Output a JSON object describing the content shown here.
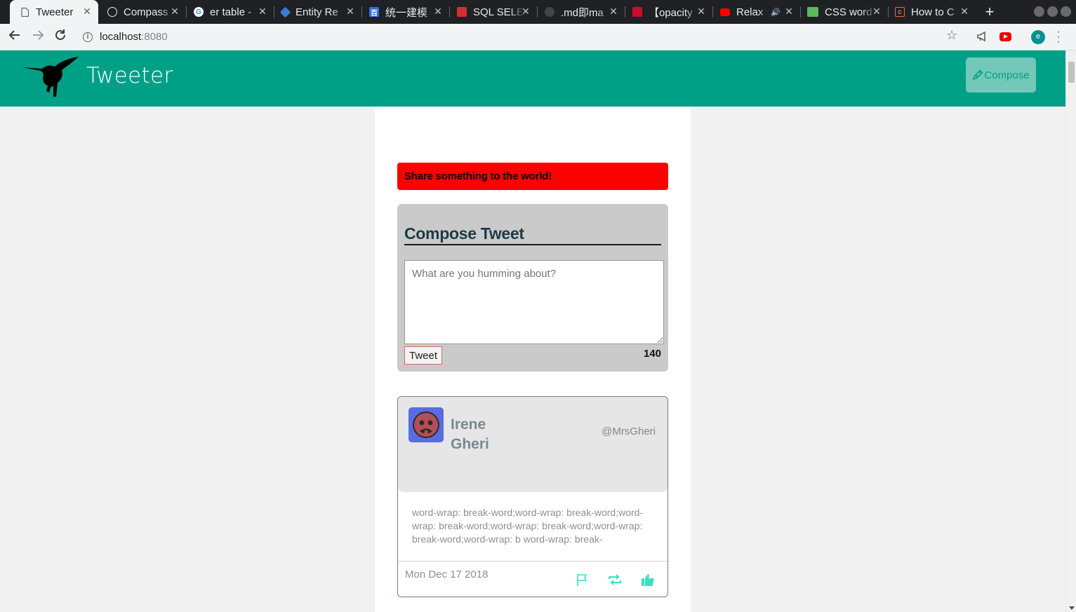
{
  "browser": {
    "tabs": [
      {
        "title": "Tweeter",
        "icon": "doc-icon",
        "active": true
      },
      {
        "title": "Compass",
        "icon": "compass-icon"
      },
      {
        "title": "er table -",
        "icon": "google-icon"
      },
      {
        "title": "Entity Re",
        "icon": "puzzle-icon"
      },
      {
        "title": "统一建模",
        "icon": "baidu-icon"
      },
      {
        "title": "SQL SELE",
        "icon": "sql-icon"
      },
      {
        "title": ".md即ma",
        "icon": "github-icon"
      },
      {
        "title": "【opacity",
        "icon": "csdn-icon"
      },
      {
        "title": "Relax",
        "icon": "youtube-icon"
      },
      {
        "title": "CSS word",
        "icon": "css-icon"
      },
      {
        "title": "How to C",
        "icon": "codepen-icon"
      }
    ],
    "url_host": "localhost",
    "url_port": ":8080",
    "profile_initial": "e"
  },
  "header": {
    "brand": "Tweeter",
    "compose_label": "Compose"
  },
  "alert": {
    "text": "Share something to the world!"
  },
  "compose": {
    "title": "Compose Tweet",
    "placeholder": "What are you humming about?",
    "button_label": "Tweet",
    "counter": "140"
  },
  "tweet": {
    "name": "Irene Gheri",
    "handle": "@MrsGheri",
    "body": "word-wrap: break-word;word-wrap: break-word;word-wrap: break-word;word-wrap: break-word;word-wrap: break-word;word-wrap: b word-wrap: break-",
    "date": "Mon Dec 17 2018"
  },
  "colors": {
    "header_bg": "#00a087",
    "alert_bg": "#ff0000",
    "action_icon": "#3ee0c2"
  }
}
